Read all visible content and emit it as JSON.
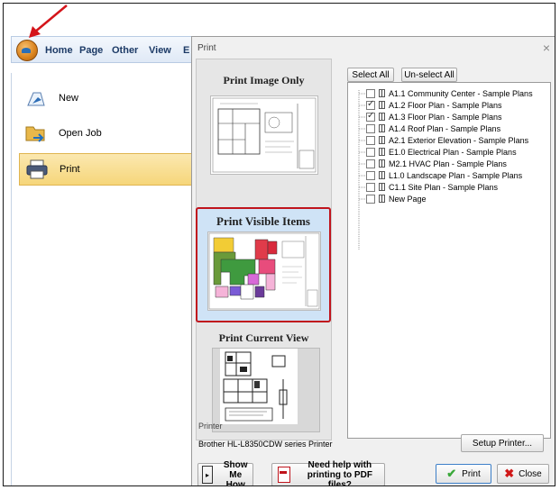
{
  "app": {
    "menu_tabs": [
      "Home",
      "Page",
      "Other",
      "View",
      "E"
    ],
    "items": [
      {
        "label": "New",
        "icon": "new-document-icon"
      },
      {
        "label": "Open Job",
        "icon": "open-folder-icon"
      },
      {
        "label": "Print",
        "icon": "printer-icon"
      }
    ]
  },
  "dialog": {
    "title": "Print",
    "close": "×",
    "options": [
      {
        "label": "Print Image Only"
      },
      {
        "label": "Print Visible Items"
      },
      {
        "label": "Print Current View"
      }
    ],
    "select_all": "Select All",
    "unselect_all": "Un-select All",
    "pages": [
      {
        "label": "A1.1 Community Center - Sample Plans",
        "checked": false
      },
      {
        "label": "A1.2 Floor Plan - Sample Plans",
        "checked": true
      },
      {
        "label": "A1.3 Floor Plan - Sample Plans",
        "checked": true
      },
      {
        "label": "A1.4 Roof Plan - Sample Plans",
        "checked": false
      },
      {
        "label": "A2.1 Exterior Elevation - Sample Plans",
        "checked": false
      },
      {
        "label": "E1.0 Electrical Plan - Sample Plans",
        "checked": false
      },
      {
        "label": "M2.1 HVAC Plan - Sample Plans",
        "checked": false
      },
      {
        "label": "L1.0 Landscape Plan - Sample Plans",
        "checked": false
      },
      {
        "label": "C1.1 Site Plan - Sample Plans",
        "checked": false
      },
      {
        "label": "New Page",
        "checked": false
      }
    ],
    "printer_label": "Printer",
    "printer_name": "Brother HL-L8350CDW series Printer",
    "setup_printer": "Setup Printer...",
    "show_me": "Show Me\nHow",
    "pdf_help": "Need help with\nprinting to PDF files?",
    "print": "Print",
    "close_button": "Close"
  },
  "colors": {
    "highlight_border": "#c0141c",
    "selected_option_bg": "#cfe3f6",
    "arrow": "#d4141a"
  }
}
